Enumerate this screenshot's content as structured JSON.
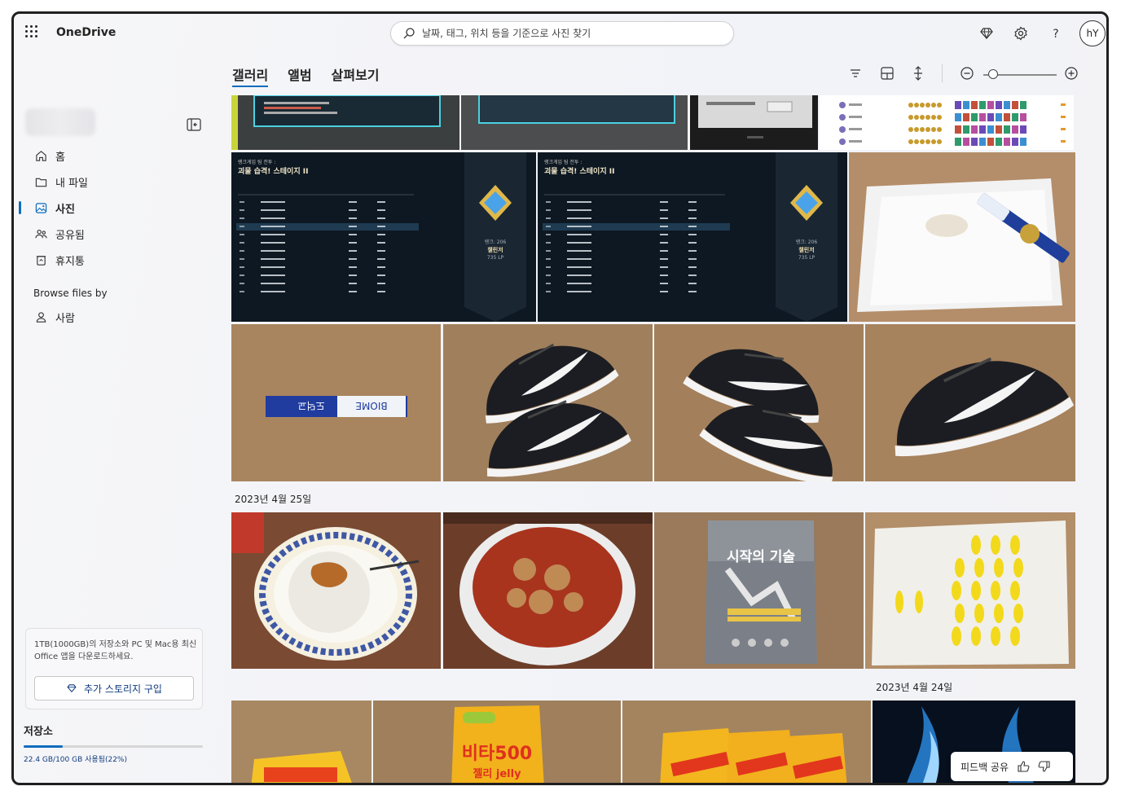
{
  "app": {
    "name": "OneDrive"
  },
  "search": {
    "placeholder": "날짜, 태그, 위치 등을 기준으로 사진 찾기"
  },
  "header_icons": [
    "premium-diamond-icon",
    "settings-gear-icon",
    "help-icon"
  ],
  "user": {
    "initials": "hY"
  },
  "sidebar": {
    "items": [
      {
        "label": "홈",
        "icon": "home-icon"
      },
      {
        "label": "내 파일",
        "icon": "folder-icon"
      },
      {
        "label": "사진",
        "icon": "photo-icon",
        "active": true
      },
      {
        "label": "공유됨",
        "icon": "people-icon"
      },
      {
        "label": "휴지통",
        "icon": "recycle-bin-icon"
      }
    ],
    "section_title": "Browse files by",
    "section_items": [
      {
        "label": "사람",
        "icon": "person-icon"
      }
    ],
    "promo_text": "1TB(1000GB)의 저장소와 PC 및 Mac용 최신 Office 앱을 다운로드하세요.",
    "promo_button": "추가 스토리지 구입",
    "storage_title": "저장소",
    "storage_text": "22.4 GB/100 GB 사용됨(22%)",
    "storage_percent": 22
  },
  "tabs": [
    {
      "label": "갤러리",
      "active": true
    },
    {
      "label": "앨범"
    },
    {
      "label": "살펴보기"
    }
  ],
  "toolbar_icons": [
    "filter-icon",
    "layout-icon",
    "sort-icon",
    "zoom-out-icon",
    "zoom-in-icon"
  ],
  "gallery": {
    "date_labels": [
      "2023년 4월 25일",
      "2023년 4월 24일"
    ],
    "game_screens": [
      {
        "mode": "랭크게임 팀 전투 :",
        "title": "괴물 습격! 스테이지 II",
        "rank": "챌린저",
        "lp": "735 LP",
        "rank_caption": "랭크: 206"
      },
      {
        "mode": "랭크게임 팀 전투 :",
        "title": "괴물 습격! 스테이지 II",
        "rank": "챌린저",
        "lp": "735 LP",
        "rank_caption": "랭크: 206"
      }
    ],
    "book_title": "시작의 기술",
    "jelly_brand": "비타500",
    "jelly_sub": "젤리 jelly"
  },
  "feedback": {
    "label": "피드백 공유"
  },
  "colors": {
    "accent": "#0f6cbd",
    "sidebar_bg": "#f3f3f6"
  }
}
